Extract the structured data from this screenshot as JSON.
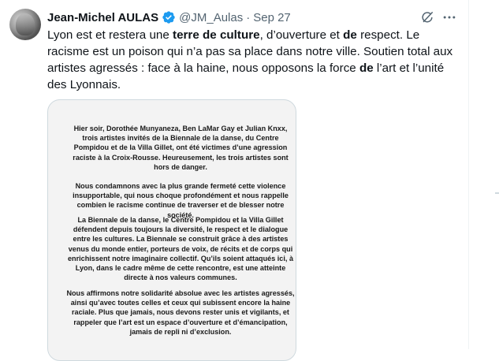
{
  "tweet": {
    "author_name": "Jean-Michel AULAS",
    "handle": "@JM_Aulas",
    "separator": "·",
    "date": "Sep 27",
    "icons": {
      "avatar": "profile-photo",
      "verified": "verified-badge-icon",
      "grok": "grok-icon",
      "more": "more-icon"
    },
    "text_segments": [
      {
        "t": "Lyon est et restera une ",
        "b": false
      },
      {
        "t": "terre de culture",
        "b": true
      },
      {
        "t": ", d’ouverture et ",
        "b": false
      },
      {
        "t": "de",
        "b": true
      },
      {
        "t": " respect. Le racisme est un poison qui n’a pas sa place dans notre ville. Soutien total aux artistes agressés : face à la haine, nous opposons la force ",
        "b": false
      },
      {
        "t": "de",
        "b": true
      },
      {
        "t": " l’art et l’unité des Lyonnais.",
        "b": false
      }
    ]
  },
  "document": {
    "paragraphs": [
      "Hier soir, Dorothée Munyaneza, Ben LaMar Gay et Julian Knxx, trois artistes invités de la Biennale de la danse, du Centre Pompidou et de la Villa Gillet, ont été victimes d’une agression raciste à la Croix-Rousse. Heureusement, les trois artistes sont hors de danger.",
      "Nous condamnons avec la plus grande fermeté cette violence insupportable, qui nous choque profondément et nous rappelle combien le racisme continue de traverser et de blesser notre société.",
      "La Biennale de la danse, le Centre Pompidou et la Villa Gillet défendent depuis toujours la diversité, le respect et le dialogue entre les cultures. La Biennale se construit grâce à des artistes venus du monde entier, porteurs de voix, de récits et de corps qui enrichissent notre imaginaire collectif. Qu’ils soient attaqués ici, à Lyon, dans le cadre même de cette rencontre, est une atteinte directe à nos valeurs communes.",
      "Nous affirmons notre solidarité absolue avec les artistes agressés, ainsi qu’avec toutes celles et ceux qui subissent encore la haine raciale. Plus que jamais, nous devons rester unis et vigilants, et rappeler que l’art est un espace d’ouverture et d’émancipation, jamais de repli ni d’exclusion."
    ]
  },
  "colors": {
    "text": "#0f1419",
    "muted": "#536471",
    "verified": "#1d9bf0",
    "border": "#cfd9de"
  }
}
